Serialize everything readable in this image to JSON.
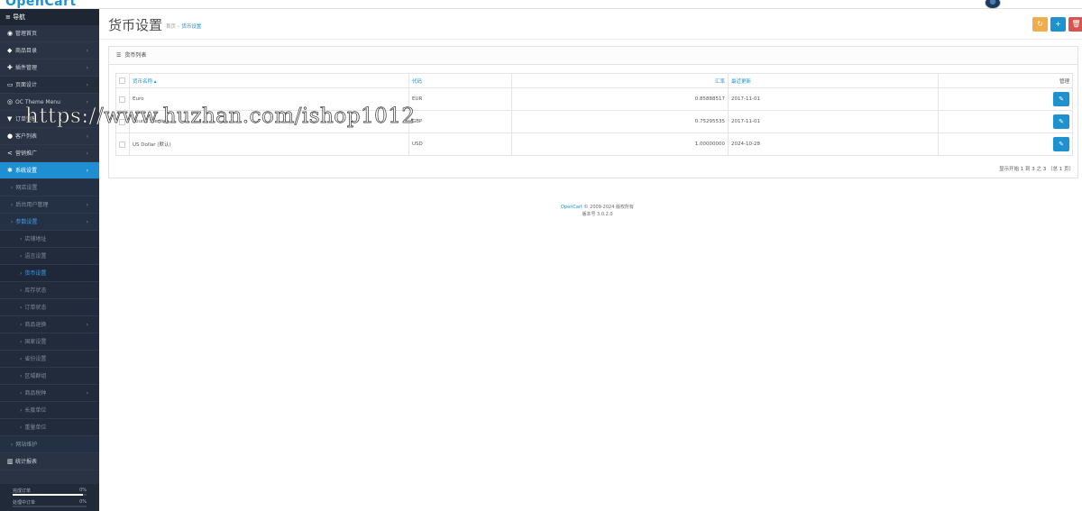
{
  "app": {
    "logo": "OpenCart"
  },
  "nav": {
    "header": "≡ 导航",
    "items": [
      {
        "label": "管理首页",
        "icon": "dashboard-icon",
        "glyph": "◉",
        "chev": ""
      },
      {
        "label": "商品目录",
        "icon": "tag-icon",
        "glyph": "◆",
        "chev": "›"
      },
      {
        "label": "插件管理",
        "icon": "puzzle-icon",
        "glyph": "✚",
        "chev": "›"
      },
      {
        "label": "页面设计",
        "icon": "monitor-icon",
        "glyph": "▭",
        "chev": "›"
      },
      {
        "label": "OC Theme Menu",
        "icon": "circle-icon",
        "glyph": "◎",
        "chev": "›"
      },
      {
        "label": "订单销售",
        "icon": "cart-icon",
        "glyph": "▼",
        "chev": ""
      },
      {
        "label": "客户列表",
        "icon": "user-icon",
        "glyph": "●",
        "chev": "›"
      },
      {
        "label": "营销推广",
        "icon": "share-icon",
        "glyph": "<",
        "chev": "›"
      },
      {
        "label": "系统设置",
        "icon": "cog-icon",
        "glyph": "✱",
        "chev": "›"
      }
    ],
    "system_sub": [
      {
        "label": "网店设置",
        "chev": ""
      },
      {
        "label": "后台用户管理",
        "chev": "›"
      },
      {
        "label": "参数设置",
        "chev": "›"
      }
    ],
    "params_sub": [
      "店铺地址",
      "语言设置",
      "货币设置",
      "库存状态",
      "订单状态",
      "商品退换",
      "国家设置",
      "省份设置",
      "区域群组",
      "商品税种",
      "长度单位",
      "重量单位"
    ],
    "params_sub_chev": [
      "",
      "",
      "",
      "",
      "",
      "›",
      "",
      "",
      "",
      "›",
      "",
      ""
    ],
    "maintenance": "网站维护",
    "reports": "统计报表",
    "reports_glyph": "▥"
  },
  "stats": [
    {
      "label": "完成订单",
      "percent": "0%",
      "fill": 0.95
    },
    {
      "label": "处理中订单",
      "percent": "0%",
      "fill": 0
    }
  ],
  "header": {
    "title": "货币设置",
    "breadcrumb": [
      "首页",
      "货币设置"
    ]
  },
  "toolbar": {
    "refresh": "↻",
    "add": "+",
    "delete": "🗑"
  },
  "panel": {
    "title": "货币列表",
    "columns": {
      "name": "货币名称 ▴",
      "code": "代码",
      "rate": "汇率",
      "updated": "最近更新",
      "action": "管理"
    },
    "rows": [
      {
        "name": "Euro",
        "code": "EUR",
        "rate": "0.85888517",
        "updated": "2017-11-01"
      },
      {
        "name": "Pound Sterling",
        "code": "GBP",
        "rate": "0.75295535",
        "updated": "2017-11-01"
      },
      {
        "name": "US Dollar (默认)",
        "code": "USD",
        "rate": "1.00000000",
        "updated": "2024-10-28"
      }
    ],
    "pagination": "显示开始 1 到 3 之 3 （总 1 页）"
  },
  "footer": {
    "link": "OpenCart",
    "copyright": " © 2009-2024 版权所有",
    "version": "版本号 3.0.2.0"
  },
  "watermark": "https://www.huzhan.com/ishop1012",
  "colors": {
    "primary": "#1e91cf",
    "warning": "#f0ad4e",
    "danger": "#d9534f",
    "sidebar": "#2a3344"
  }
}
